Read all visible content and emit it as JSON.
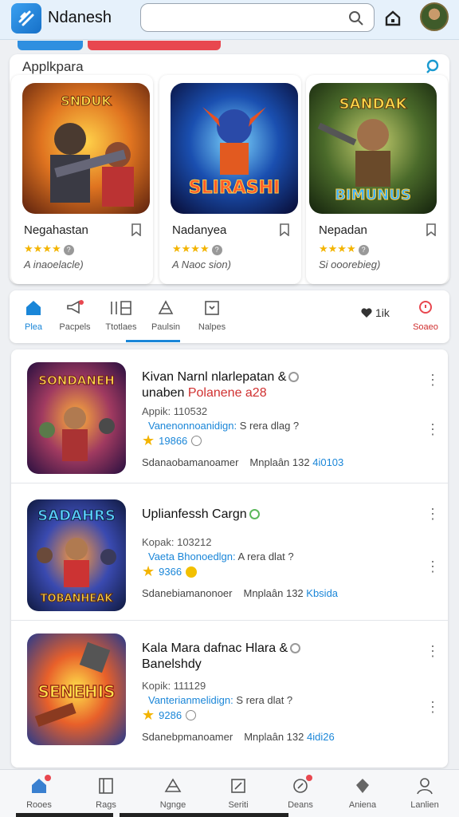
{
  "header": {
    "app_title": "Ndanesh",
    "search_placeholder": ""
  },
  "featured": {
    "title": "Applkpara",
    "cards": [
      {
        "name": "Negahastan",
        "stars": "★★★★",
        "subtitle": "A inaoelacle)"
      },
      {
        "name": "Nadanyea",
        "stars": "★★★★",
        "subtitle": "A Naoc sion)"
      },
      {
        "name": "Nepadan",
        "stars": "★★★★",
        "subtitle": "Si ooorebieg)"
      }
    ]
  },
  "categories": {
    "items": [
      {
        "label": "Plea",
        "icon": "home-icon",
        "active": true
      },
      {
        "label": "Pacpels",
        "icon": "megaphone-icon"
      },
      {
        "label": "Ttotlaes",
        "icon": "grid-icon"
      },
      {
        "label": "Paulsin",
        "icon": "triangle-icon"
      },
      {
        "label": "Nalpes",
        "icon": "bookmark-icon"
      }
    ],
    "count": "1ik",
    "right": {
      "label": "Soaeo",
      "icon": "search-icon"
    }
  },
  "list": [
    {
      "title1": "Kivan Narnl nlarlepatan &",
      "title2a": "unaben",
      "title2b": "Polanene a28",
      "meta1": "Appik: 110532",
      "meta2a": "Vanenonnoanidign:",
      "meta2b": " S rera dlag ?",
      "rating": "19866",
      "footer_a": "Sdanaobamanoamer",
      "footer_b": "Mnplaân 132",
      "footer_c": "4i0103"
    },
    {
      "title1": "Uplianfessh Cargn",
      "title2a": "",
      "title2b": "",
      "meta1": "Kopak: 103212",
      "meta2a": "Vaeta Bhonoedlgn:",
      "meta2b": " A rera dlat ?",
      "rating": "9366",
      "footer_a": "Sdanebiamanonoer",
      "footer_b": "Mnplaân 132",
      "footer_c": "Kbsida"
    },
    {
      "title1": "Kala Mara dafnac Hlara &",
      "title2a": "Banelshdy",
      "title2b": "",
      "meta1": "Kopik: 111129",
      "meta2a": "Vanterianmelidign:",
      "meta2b": " S rera dlat ?",
      "rating": "9286",
      "footer_a": "Sdanebpmanoamer",
      "footer_b": "Mnplaân 132",
      "footer_c": "4idi26"
    }
  ],
  "bottom_nav": [
    {
      "label": "Rooes",
      "icon": "home-icon"
    },
    {
      "label": "Rags",
      "icon": "book-icon"
    },
    {
      "label": "Ngnge",
      "icon": "triangle-icon"
    },
    {
      "label": "Seriti",
      "icon": "edit-icon"
    },
    {
      "label": "Deans",
      "icon": "compass-icon"
    },
    {
      "label": "Aniena",
      "icon": "shield-icon"
    },
    {
      "label": "Lanlien",
      "icon": "user-icon"
    }
  ],
  "colors": {
    "accent": "#1a86d8",
    "danger": "#e8474f",
    "star": "#f3b400"
  }
}
